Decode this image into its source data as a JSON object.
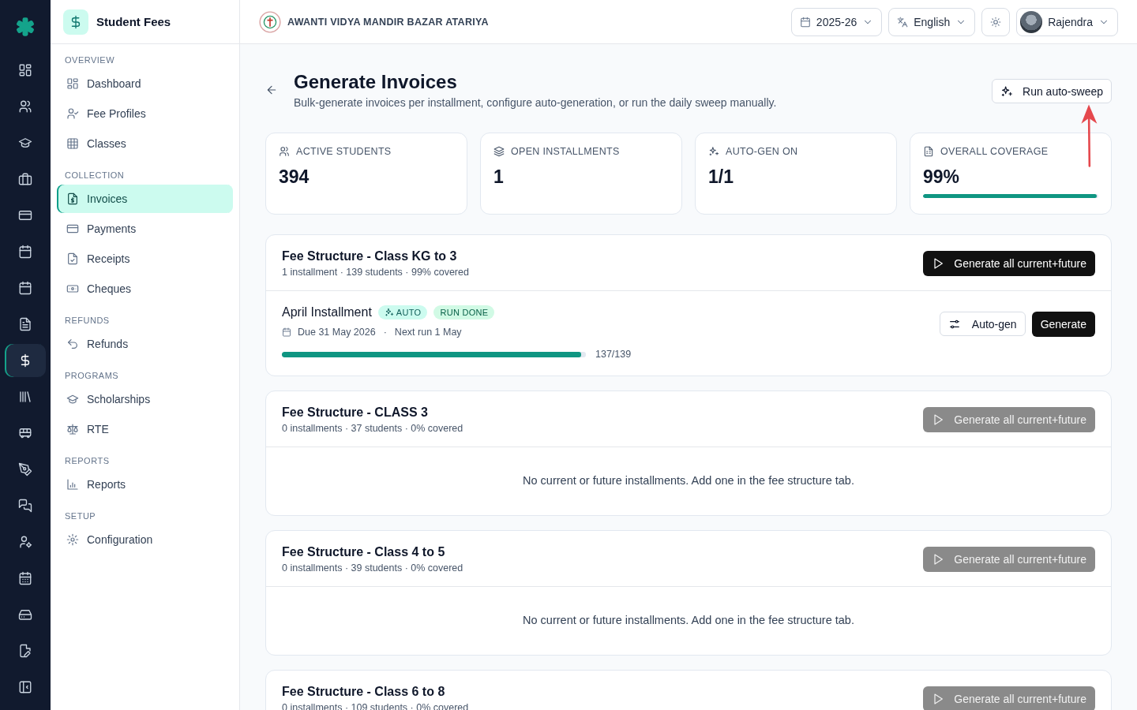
{
  "rail": [
    {
      "selected": false
    },
    {
      "selected": false
    },
    {
      "selected": false
    },
    {
      "selected": false
    },
    {
      "selected": false
    },
    {
      "selected": false
    },
    {
      "selected": false
    },
    {
      "selected": false
    },
    {
      "selected": true
    },
    {
      "selected": false
    },
    {
      "selected": false
    },
    {
      "selected": false
    },
    {
      "selected": false
    },
    {
      "selected": false
    },
    {
      "selected": false
    },
    {
      "selected": false
    },
    {
      "selected": false
    }
  ],
  "sidebar": {
    "title": "Student Fees",
    "sections": [
      {
        "heading": "OVERVIEW",
        "items": [
          {
            "label": "Dashboard",
            "selected": false
          },
          {
            "label": "Fee Profiles",
            "selected": false
          },
          {
            "label": "Classes",
            "selected": false
          }
        ]
      },
      {
        "heading": "COLLECTION",
        "items": [
          {
            "label": "Invoices",
            "selected": true
          },
          {
            "label": "Payments",
            "selected": false
          },
          {
            "label": "Receipts",
            "selected": false
          },
          {
            "label": "Cheques",
            "selected": false
          }
        ]
      },
      {
        "heading": "REFUNDS",
        "items": [
          {
            "label": "Refunds",
            "selected": false
          }
        ]
      },
      {
        "heading": "PROGRAMS",
        "items": [
          {
            "label": "Scholarships",
            "selected": false
          },
          {
            "label": "RTE",
            "selected": false
          }
        ]
      },
      {
        "heading": "REPORTS",
        "items": [
          {
            "label": "Reports",
            "selected": false
          }
        ]
      },
      {
        "heading": "SETUP",
        "items": [
          {
            "label": "Configuration",
            "selected": false
          }
        ]
      }
    ]
  },
  "topbar": {
    "school": "AWANTI VIDYA MANDIR BAZAR ATARIYA",
    "year": "2025-26",
    "language": "English",
    "user": "Rajendra"
  },
  "page": {
    "title": "Generate Invoices",
    "subtitle": "Bulk-generate invoices per installment, configure auto-generation, or run the daily sweep manually.",
    "action": "Run auto-sweep"
  },
  "annotation": {
    "kind": "arrow"
  },
  "stats": [
    {
      "label": "ACTIVE STUDENTS",
      "value": "394"
    },
    {
      "label": "OPEN INSTALLMENTS",
      "value": "1"
    },
    {
      "label": "AUTO-GEN ON",
      "value": "1/1"
    },
    {
      "label": "OVERALL COVERAGE",
      "value": "99%",
      "level": 0.99
    }
  ],
  "fee_structures": [
    {
      "title": "Fee Structure - Class KG to 3",
      "meta": "1 installment · 139 students · 99% covered",
      "button": {
        "label": "Generate all current+future",
        "disabled": false
      },
      "installments": [
        {
          "name": "April Installment",
          "badges": [
            {
              "label": "AUTO",
              "kind": "auto"
            },
            {
              "label": "RUN DONE",
              "kind": "done"
            }
          ],
          "due": "Due 31 May 2026",
          "separator": "·",
          "next_run": "Next run 1 May",
          "level": 0.9856,
          "count": "137/139",
          "buttons": [
            "Auto-gen",
            "Generate"
          ]
        }
      ]
    },
    {
      "title": "Fee Structure - CLASS 3",
      "meta": "0 installments · 37 students · 0% covered",
      "button": {
        "label": "Generate all current+future",
        "disabled": true
      },
      "empty": "No current or future installments. Add one in the fee structure tab."
    },
    {
      "title": "Fee Structure - Class 4 to 5",
      "meta": "0 installments · 39 students · 0% covered",
      "button": {
        "label": "Generate all current+future",
        "disabled": true
      },
      "empty": "No current or future installments. Add one in the fee structure tab."
    },
    {
      "title": "Fee Structure - Class 6 to 8",
      "meta": "0 installments · 109 students · 0% covered",
      "button": {
        "label": "Generate all current+future",
        "disabled": true
      }
    }
  ]
}
